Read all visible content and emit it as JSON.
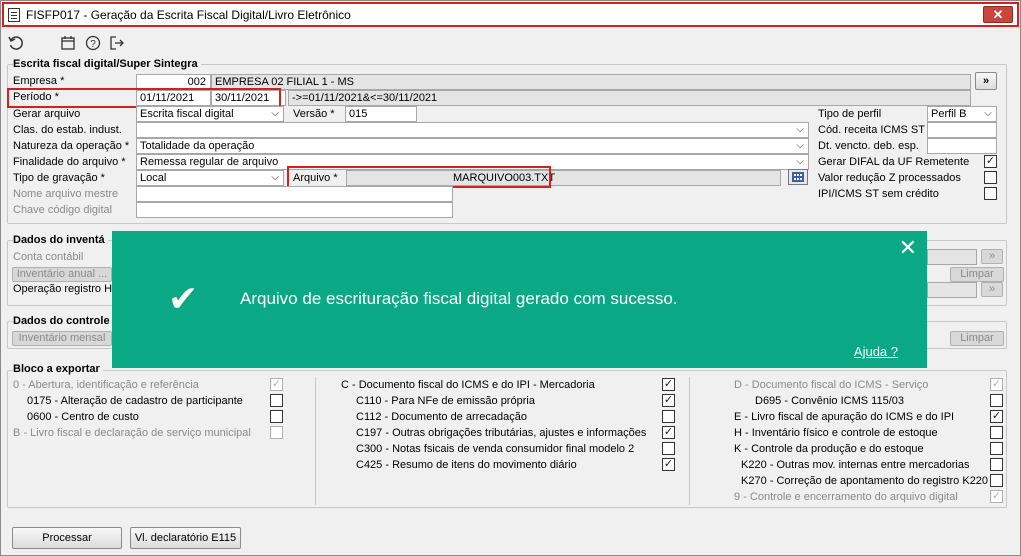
{
  "window": {
    "title": "FISFP017 - Geração da Escrita Fiscal Digital/Livro Eletrônico",
    "close_glyph": "✕"
  },
  "toolbar": {
    "icons": [
      "refresh-icon",
      "calendar-icon",
      "help-icon",
      "exit-icon"
    ]
  },
  "sped_group": {
    "title": "Escrita fiscal digital/Super Sintegra",
    "empresa_label": "Empresa *",
    "empresa_code": "002",
    "empresa_name": "EMPRESA 02 FILIAL 1 - MS",
    "more_button": "»",
    "periodo_label": "Período *",
    "periodo_inicio": "01/11/2021",
    "periodo_fim": "30/11/2021",
    "periodo_filter": "->=01/11/2021&<=30/11/2021",
    "gerar_label": "Gerar arquivo",
    "gerar_value": "Escrita fiscal digital",
    "versao_label": "Versão *",
    "versao_value": "015",
    "clas_label": "Clas. do estab. indust.",
    "clas_value": "",
    "natureza_label": "Natureza da operação *",
    "natureza_value": "Totalidade da operação",
    "finalidade_label": "Finalidade do arquivo *",
    "finalidade_value": "Remessa regular de arquivo",
    "tipo_grav_label": "Tipo de gravação *",
    "tipo_grav_value": "Local",
    "arquivo_label": "Arquivo *",
    "arquivo_value": "MARQUIVO003.TXT",
    "nome_mestre_label": "Nome arquivo mestre",
    "chave_label": "Chave código digital",
    "tipo_perfil_label": "Tipo de perfil",
    "tipo_perfil_value": "Perfil B",
    "cod_receita_label": "Cód. receita ICMS ST",
    "dt_vencto_label": "Dt. vencto. deb. esp.",
    "gerar_difal_label": "Gerar DIFAL da UF Remetente",
    "valor_reducao_label": "Valor redução Z processados",
    "ipi_icms_label": "IPI/ICMS ST sem crédito"
  },
  "inventario_group": {
    "title": "Dados do inventá",
    "conta_label": "Conta contábil",
    "inventario_button": "Inventário anual ...",
    "operacao_label": "Operação registro H",
    "limpar": "Limpar",
    "dots": "»"
  },
  "controle_group": {
    "title": "Dados do controle",
    "inventario_mensal": "Inventário mensal",
    "limpar": "Limpar"
  },
  "bloco_group": {
    "title": "Bloco a exportar",
    "col1": [
      {
        "label": "0 - Abertura, identificação e referência",
        "checked": "✓",
        "enabled": false
      },
      {
        "label": "0175 - Alteração de cadastro de participante",
        "checked": "",
        "enabled": true
      },
      {
        "label": "0600 - Centro de custo",
        "checked": "",
        "enabled": true
      },
      {
        "label": "B - Livro fiscal e declaração de serviço municipal",
        "checked": "",
        "enabled": false
      }
    ],
    "col2": [
      {
        "label": "C - Documento fiscal do ICMS e do IPI - Mercadoria",
        "checked": "✓"
      },
      {
        "label": "C110 - Para NFe de emissão própria",
        "checked": "✓"
      },
      {
        "label": "C112 - Documento de arrecadação",
        "checked": ""
      },
      {
        "label": "C197 - Outras obrigações tributárias, ajustes e informações",
        "checked": "✓"
      },
      {
        "label": "C300 - Notas fsicais de venda consumidor final modelo 2",
        "checked": ""
      },
      {
        "label": "C425 - Resumo de itens do movimento diário",
        "checked": "✓"
      }
    ],
    "col3": [
      {
        "label": "D - Documento fiscal do ICMS - Serviço",
        "checked": "✓",
        "enabled": false
      },
      {
        "label": "D695 - Convênio ICMS 115/03",
        "checked": "",
        "enabled": true
      },
      {
        "label": "E - Livro fiscal de apuração do ICMS e do IPI",
        "checked": "✓",
        "enabled": true
      },
      {
        "label": "H - Inventário físico e controle de estoque",
        "checked": "",
        "enabled": true
      },
      {
        "label": "K - Controle da produção e do estoque",
        "checked": "",
        "enabled": true
      },
      {
        "label": "K220 - Outras mov. internas entre mercadorias",
        "checked": "",
        "enabled": true
      },
      {
        "label": "K270 - Correção de apontamento do registro K220",
        "checked": "",
        "enabled": true
      },
      {
        "label": "9 - Controle e encerramento do arquivo digital",
        "checked": "✓",
        "enabled": false
      }
    ]
  },
  "footer": {
    "processar": "Processar",
    "vl_declaratorio": "Vl. declaratório E115"
  },
  "toast": {
    "message": "Arquivo de escrituração fiscal digital gerado com sucesso.",
    "help_link": "Ajuda ?",
    "close_glyph": "✕",
    "check_glyph": "✔",
    "color": "#0aa884"
  }
}
